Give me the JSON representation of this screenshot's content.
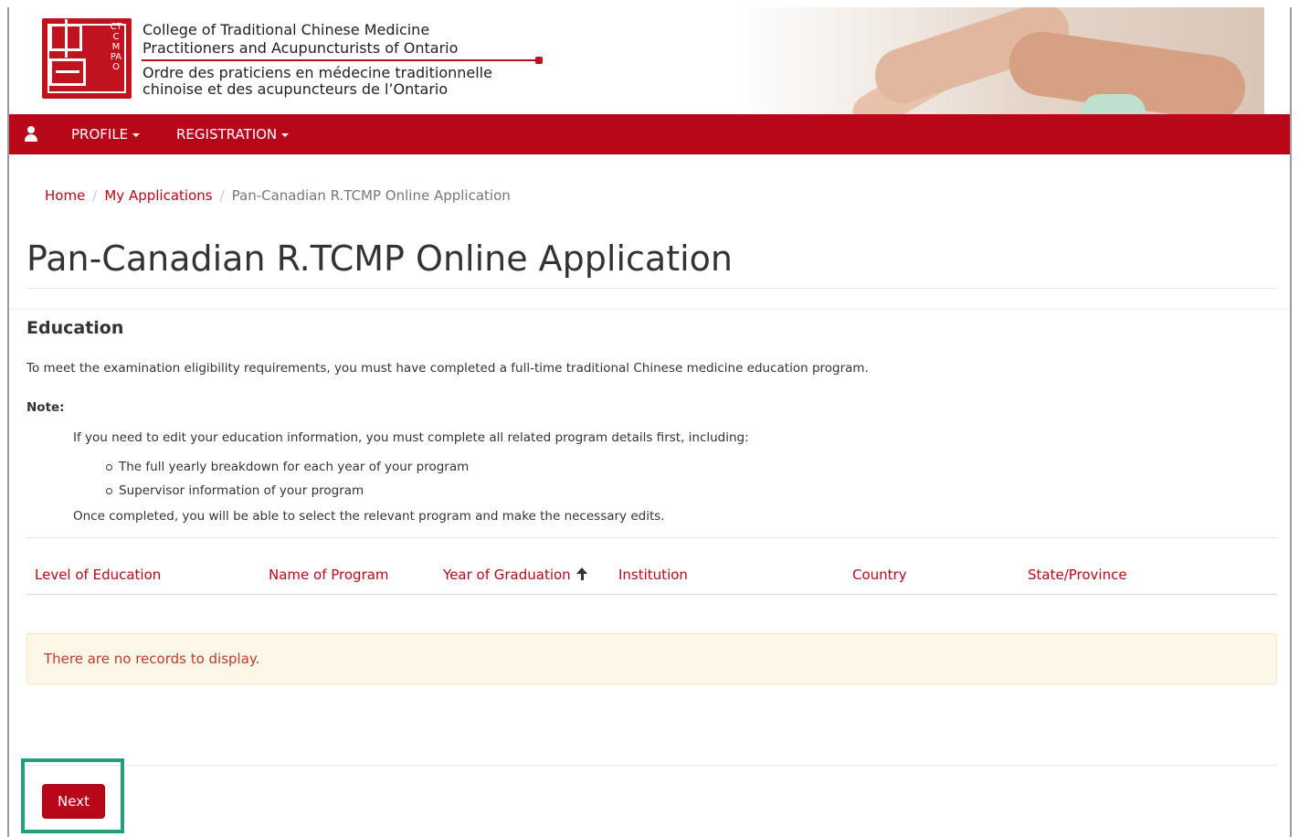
{
  "header": {
    "logo_vertical": "CTCMPAO",
    "org_name_en_line1": "College of Traditional Chinese Medicine",
    "org_name_en_line2": "Practitioners and Acupuncturists of Ontario",
    "org_name_fr_line1": "Ordre des praticiens en médecine traditionnelle",
    "org_name_fr_line2": "chinoise et des acupuncteurs de l’Ontario"
  },
  "nav": {
    "user_icon": "user-icon",
    "items": [
      {
        "label": "PROFILE"
      },
      {
        "label": "REGISTRATION"
      }
    ]
  },
  "breadcrumb": {
    "items": [
      "Home",
      "My Applications",
      "Pan-Canadian R.TCMP Online Application"
    ],
    "separator": "/"
  },
  "page": {
    "title": "Pan-Canadian R.TCMP Online Application"
  },
  "education": {
    "title": "Education",
    "intro": "To meet the examination eligibility requirements, you must have completed a full-time traditional Chinese medicine education program.",
    "note_label": "Note:",
    "note_line1": "If you need to edit your education information, you must complete all related program details first, including:",
    "bullets": [
      "The full yearly breakdown for each year of your program",
      "Supervisor information of your program"
    ],
    "note_line2": "Once completed, you will be able to select the relevant program and make the necessary edits.",
    "table": {
      "columns": [
        "Level of Education",
        "Name of Program",
        "Year of Graduation",
        "Institution",
        "Country",
        "State/Province"
      ],
      "sort_column": "Year of Graduation",
      "sort_direction": "ascending"
    },
    "empty_message": "There are no records to display."
  },
  "actions": {
    "next_label": "Next"
  },
  "colors": {
    "brand_red": "#b80718",
    "highlight_green": "#21a17a",
    "alert_bg": "#fdf7e8"
  }
}
